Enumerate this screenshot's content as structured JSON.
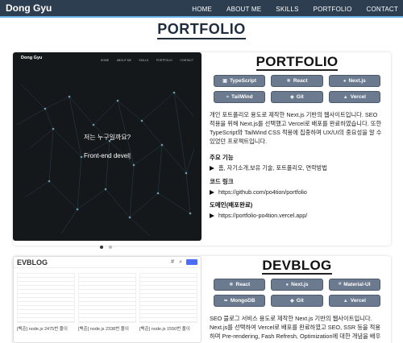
{
  "nav": {
    "brand": "Dong Gyu",
    "links": [
      "HOME",
      "ABOUT ME",
      "SKILLS",
      "PORTFOLIO",
      "CONTACT"
    ]
  },
  "section_title": "PORTFOLIO",
  "projects": [
    {
      "title": "PORTFOLIO",
      "preview": {
        "brand": "Dong Gyu",
        "links": [
          "HOME",
          "ABOUT ME",
          "SKILLS",
          "PORTFOLIO",
          "CONTACT"
        ],
        "hero_line1": "저는 누구일까요?",
        "hero_line2": "Front-end devel|"
      },
      "tags": [
        {
          "icon": "ts-icon",
          "label": "TypeScript"
        },
        {
          "icon": "react-icon",
          "label": "React"
        },
        {
          "icon": "next-icon",
          "label": "Next.js"
        },
        {
          "icon": "tailwind-icon",
          "label": "TailWind"
        },
        {
          "icon": "git-icon",
          "label": "Git"
        },
        {
          "icon": "vercel-icon",
          "label": "Vercel"
        }
      ],
      "description": "개인 포트폴리오 용도로 제작한 Next.js 기반의 웹사이트입니다. SEO 적용을 위해 Next.js를 선택했고 Vercel로 배포를 완료하였습니다. 또한 TypeScript와 TailWind CSS 적용에 집중하며 UX/UI의 중요성을 알 수 있었던 프로젝트입니다.",
      "fields": [
        {
          "label": "주요 기능",
          "value": "홈, 자기소개,보유 기술, 포트폴리오, 연락방법"
        },
        {
          "label": "코드 링크",
          "value": "https://github.com/po4tion/portfolio"
        },
        {
          "label": "도메인(배포완료)",
          "value": "https://portfolio-po4tion.vercel.app/"
        }
      ],
      "slider": {
        "count": 2,
        "active": 1
      }
    },
    {
      "title": "DEVBLOG",
      "preview": {
        "title": "EVBLOG",
        "hash": "#",
        "search_icon": "search-icon",
        "posts": [
          "[백준] node.js 2475번 풀이",
          "[백준] node.js 2338번 풀이",
          "[백준] node.js 1550번 풀이"
        ]
      },
      "tags": [
        {
          "icon": "react-icon",
          "label": "React"
        },
        {
          "icon": "next-icon",
          "label": "Next.js"
        },
        {
          "icon": "mui-icon",
          "label": "Material-UI"
        },
        {
          "icon": "mongo-icon",
          "label": "MongoDB"
        },
        {
          "icon": "git-icon",
          "label": "Git"
        },
        {
          "icon": "vercel-icon",
          "label": "Vercel"
        }
      ],
      "description": "SEO 블로그 서비스 용도로 제작한 Next.js 기반의 웹사이트입니다. Next.js를 선택하여 Vercel로 배포를 완료하였고 SEO, SSR 등을 적용하며 Pre-rendering, Fash Refresh, Optimization에 대한 개념을 배우"
    }
  ]
}
